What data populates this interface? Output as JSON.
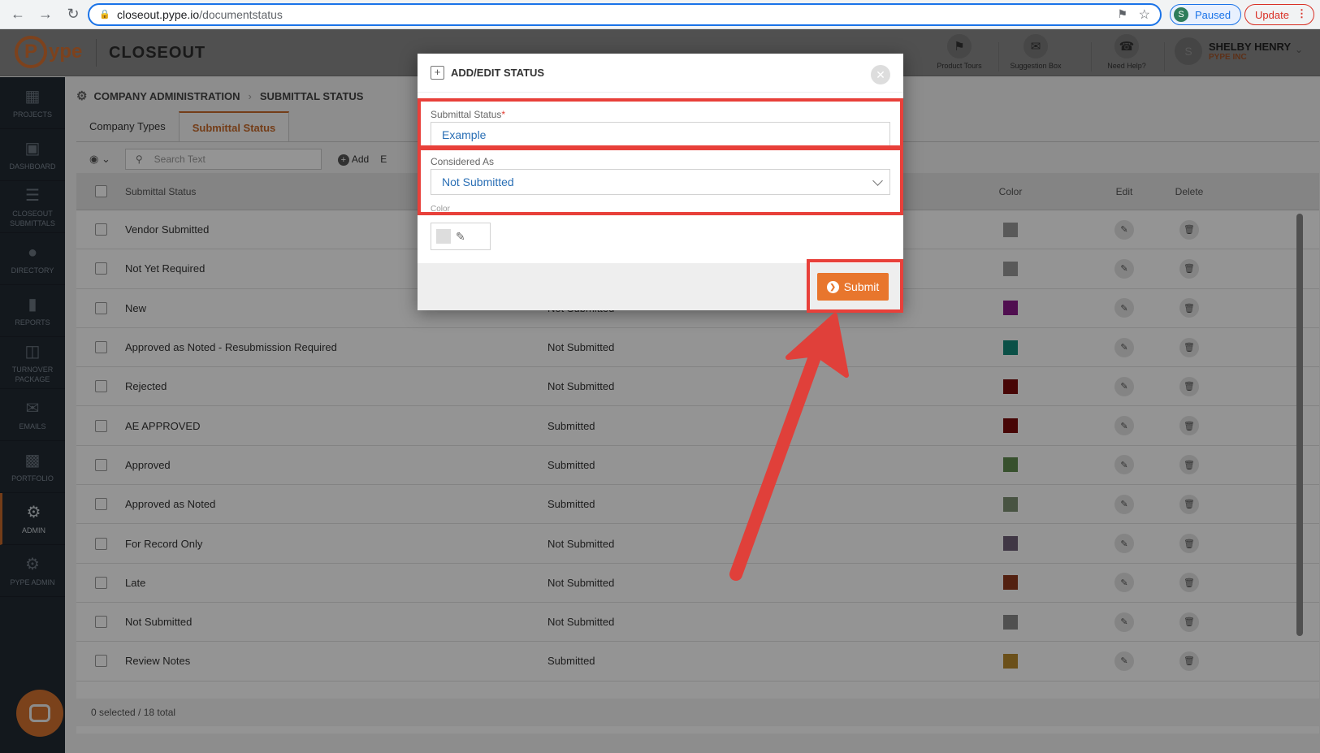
{
  "browser": {
    "url_host": "closeout.pype.io",
    "url_path": "/documentstatus",
    "profile_initial": "S",
    "profile_status": "Paused",
    "update_label": "Update"
  },
  "header": {
    "logo_initial": "P",
    "logo_text": "ype",
    "product": "CLOSEOUT",
    "buttons": [
      {
        "label": "Product Tours",
        "icon": "signpost-icon"
      },
      {
        "label": "Suggestion Box",
        "icon": "suggestion-box-icon"
      },
      {
        "label": "Need Help?",
        "icon": "phone-help-icon"
      }
    ],
    "user_initial": "S",
    "user_name": "SHELBY HENRY",
    "user_company": "PYPE INC"
  },
  "sidebar": {
    "items": [
      {
        "label": "PROJECTS",
        "icon": "building-icon"
      },
      {
        "label": "DASHBOARD",
        "icon": "monitor-icon"
      },
      {
        "label": "CLOSEOUT SUBMITTALS",
        "icon": "list-icon"
      },
      {
        "label": "DIRECTORY",
        "icon": "people-icon"
      },
      {
        "label": "REPORTS",
        "icon": "bar-chart-icon"
      },
      {
        "label": "TURNOVER PACKAGE",
        "icon": "binders-icon"
      },
      {
        "label": "EMAILS",
        "icon": "email-icon"
      },
      {
        "label": "PORTFOLIO",
        "icon": "briefcase-icon"
      },
      {
        "label": "ADMIN",
        "icon": "gear-icon"
      },
      {
        "label": "PYPE ADMIN",
        "icon": "gears-icon"
      }
    ]
  },
  "breadcrumb": {
    "root": "COMPANY ADMINISTRATION",
    "current": "SUBMITTAL STATUS"
  },
  "tabs": [
    "Company Types",
    "Submittal Status"
  ],
  "toolbar": {
    "search_placeholder": "Search Text",
    "add_label": "Add",
    "second_label": "E"
  },
  "table": {
    "headers": {
      "status": "Submittal Status",
      "color": "Color",
      "edit": "Edit",
      "delete": "Delete"
    },
    "rows": [
      {
        "status": "Vendor Submitted",
        "considered": "",
        "color": "#9a9a9a"
      },
      {
        "status": "Not Yet Required",
        "considered": "",
        "color": "#9a9a9a"
      },
      {
        "status": "New",
        "considered": "Not Submitted",
        "color": "#8a1a8a"
      },
      {
        "status": "Approved as Noted - Resubmission Required",
        "considered": "Not Submitted",
        "color": "#138a7a"
      },
      {
        "status": "Rejected",
        "considered": "Not Submitted",
        "color": "#7a0b0b"
      },
      {
        "status": "AE APPROVED",
        "considered": "Submitted",
        "color": "#7a0b0b"
      },
      {
        "status": "Approved",
        "considered": "Submitted",
        "color": "#5f8a4e"
      },
      {
        "status": "Approved as Noted",
        "considered": "Submitted",
        "color": "#7c8f72"
      },
      {
        "status": "For Record Only",
        "considered": "Not Submitted",
        "color": "#6f5f78"
      },
      {
        "status": "Late",
        "considered": "Not Submitted",
        "color": "#8f3a1e"
      },
      {
        "status": "Not Submitted",
        "considered": "Not Submitted",
        "color": "#8a8a8a"
      },
      {
        "status": "Review Notes",
        "considered": "Submitted",
        "color": "#b88a2e"
      }
    ],
    "footer": "0 selected / 18 total"
  },
  "modal": {
    "title": "ADD/EDIT STATUS",
    "status_label": "Submittal Status",
    "status_required": "*",
    "status_value": "Example",
    "considered_label": "Considered As",
    "considered_value": "Not Submitted",
    "color_label": "Color",
    "submit_label": "Submit"
  },
  "colors": {
    "accent": "#e8762d",
    "highlight": "#e8403a"
  }
}
